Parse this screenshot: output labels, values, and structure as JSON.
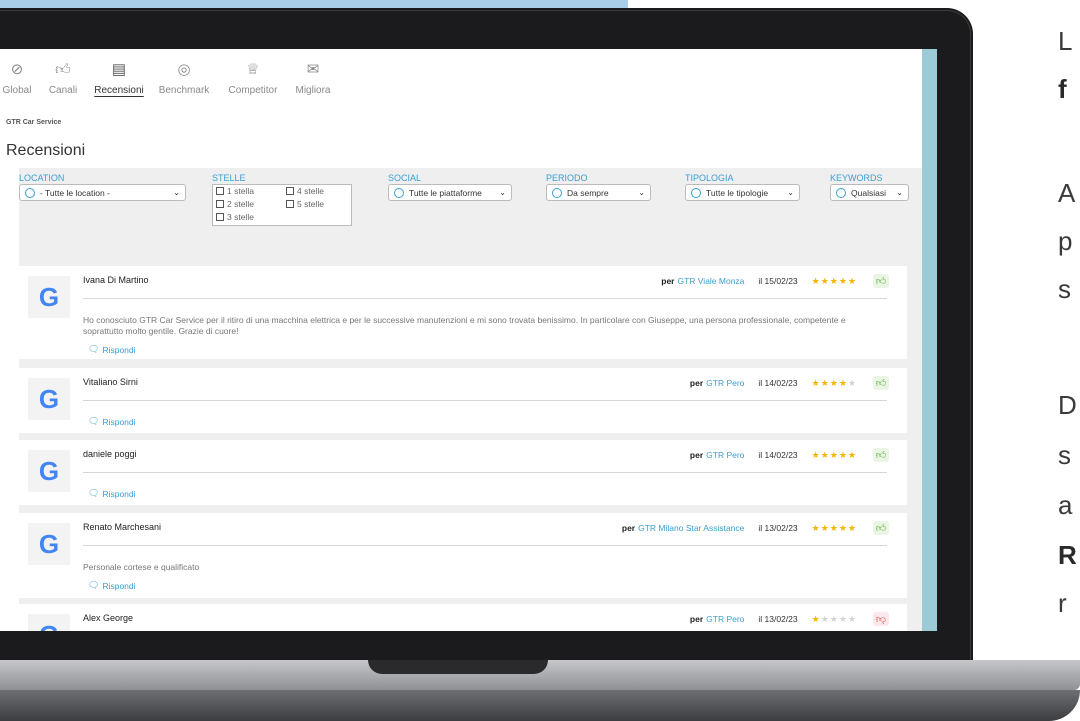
{
  "nav": {
    "items": [
      {
        "label": "Global",
        "icon": "compass-icon"
      },
      {
        "label": "Canali",
        "icon": "thumb-up-icon"
      },
      {
        "label": "Recensioni",
        "icon": "reviews-icon",
        "active": true
      },
      {
        "label": "Benchmark",
        "icon": "gauge-icon"
      },
      {
        "label": "Competitor",
        "icon": "trophy-icon"
      },
      {
        "label": "Migliora",
        "icon": "chat-icon"
      }
    ]
  },
  "company": "GTR Car Service",
  "page_title": "Recensioni",
  "filters": {
    "location": {
      "label": "LOCATION",
      "value": "- Tutte le location -"
    },
    "stelle": {
      "label": "STELLE",
      "options": [
        "1 stella",
        "2 stelle",
        "3 stelle",
        "4 stelle",
        "5 stelle"
      ]
    },
    "social": {
      "label": "SOCIAL",
      "value": "Tutte le piattaforme"
    },
    "periodo": {
      "label": "PERIODO",
      "value": "Da sempre"
    },
    "tipologia": {
      "label": "TIPOLOGIA",
      "value": "Tutte le tipologie"
    },
    "keywords": {
      "label": "KEYWORDS",
      "value": "Qualsiasi"
    }
  },
  "reply_label": "Rispondi",
  "per_label": "per",
  "reviews": [
    {
      "name": "Ivana Di Martino",
      "location": "GTR Viale Monza",
      "date": "il 15/02/23",
      "rating": 5,
      "sentiment": "positive",
      "text": "Ho conosciuto GTR Car Service per il ritiro di una macchina elettrica e per le successive manutenzioni e mi sono trovata benissimo. In particolare con Giuseppe, una persona professionale, competente e soprattutto molto gentile. Grazie di cuore!"
    },
    {
      "name": "Vitaliano Sirni",
      "location": "GTR Pero",
      "date": "il 14/02/23",
      "rating": 4,
      "sentiment": "positive",
      "text": ""
    },
    {
      "name": "daniele poggi",
      "location": "GTR Pero",
      "date": "il 14/02/23",
      "rating": 5,
      "sentiment": "positive",
      "text": ""
    },
    {
      "name": "Renato Marchesani",
      "location": "GTR Milano Star Assistance",
      "date": "il 13/02/23",
      "rating": 5,
      "sentiment": "positive",
      "text": "Personale cortese e qualificato"
    },
    {
      "name": "Alex George",
      "location": "GTR Pero",
      "date": "il 13/02/23",
      "rating": 1,
      "sentiment": "negative",
      "text": ""
    }
  ],
  "side_text": [
    "L",
    "f",
    "A",
    "p",
    "s",
    "D",
    "s",
    "a",
    "R",
    "r"
  ],
  "colors": {
    "accent": "#3a9fd0",
    "star": "#f5b400",
    "positive": "#57b23a",
    "negative": "#e54b4b"
  }
}
